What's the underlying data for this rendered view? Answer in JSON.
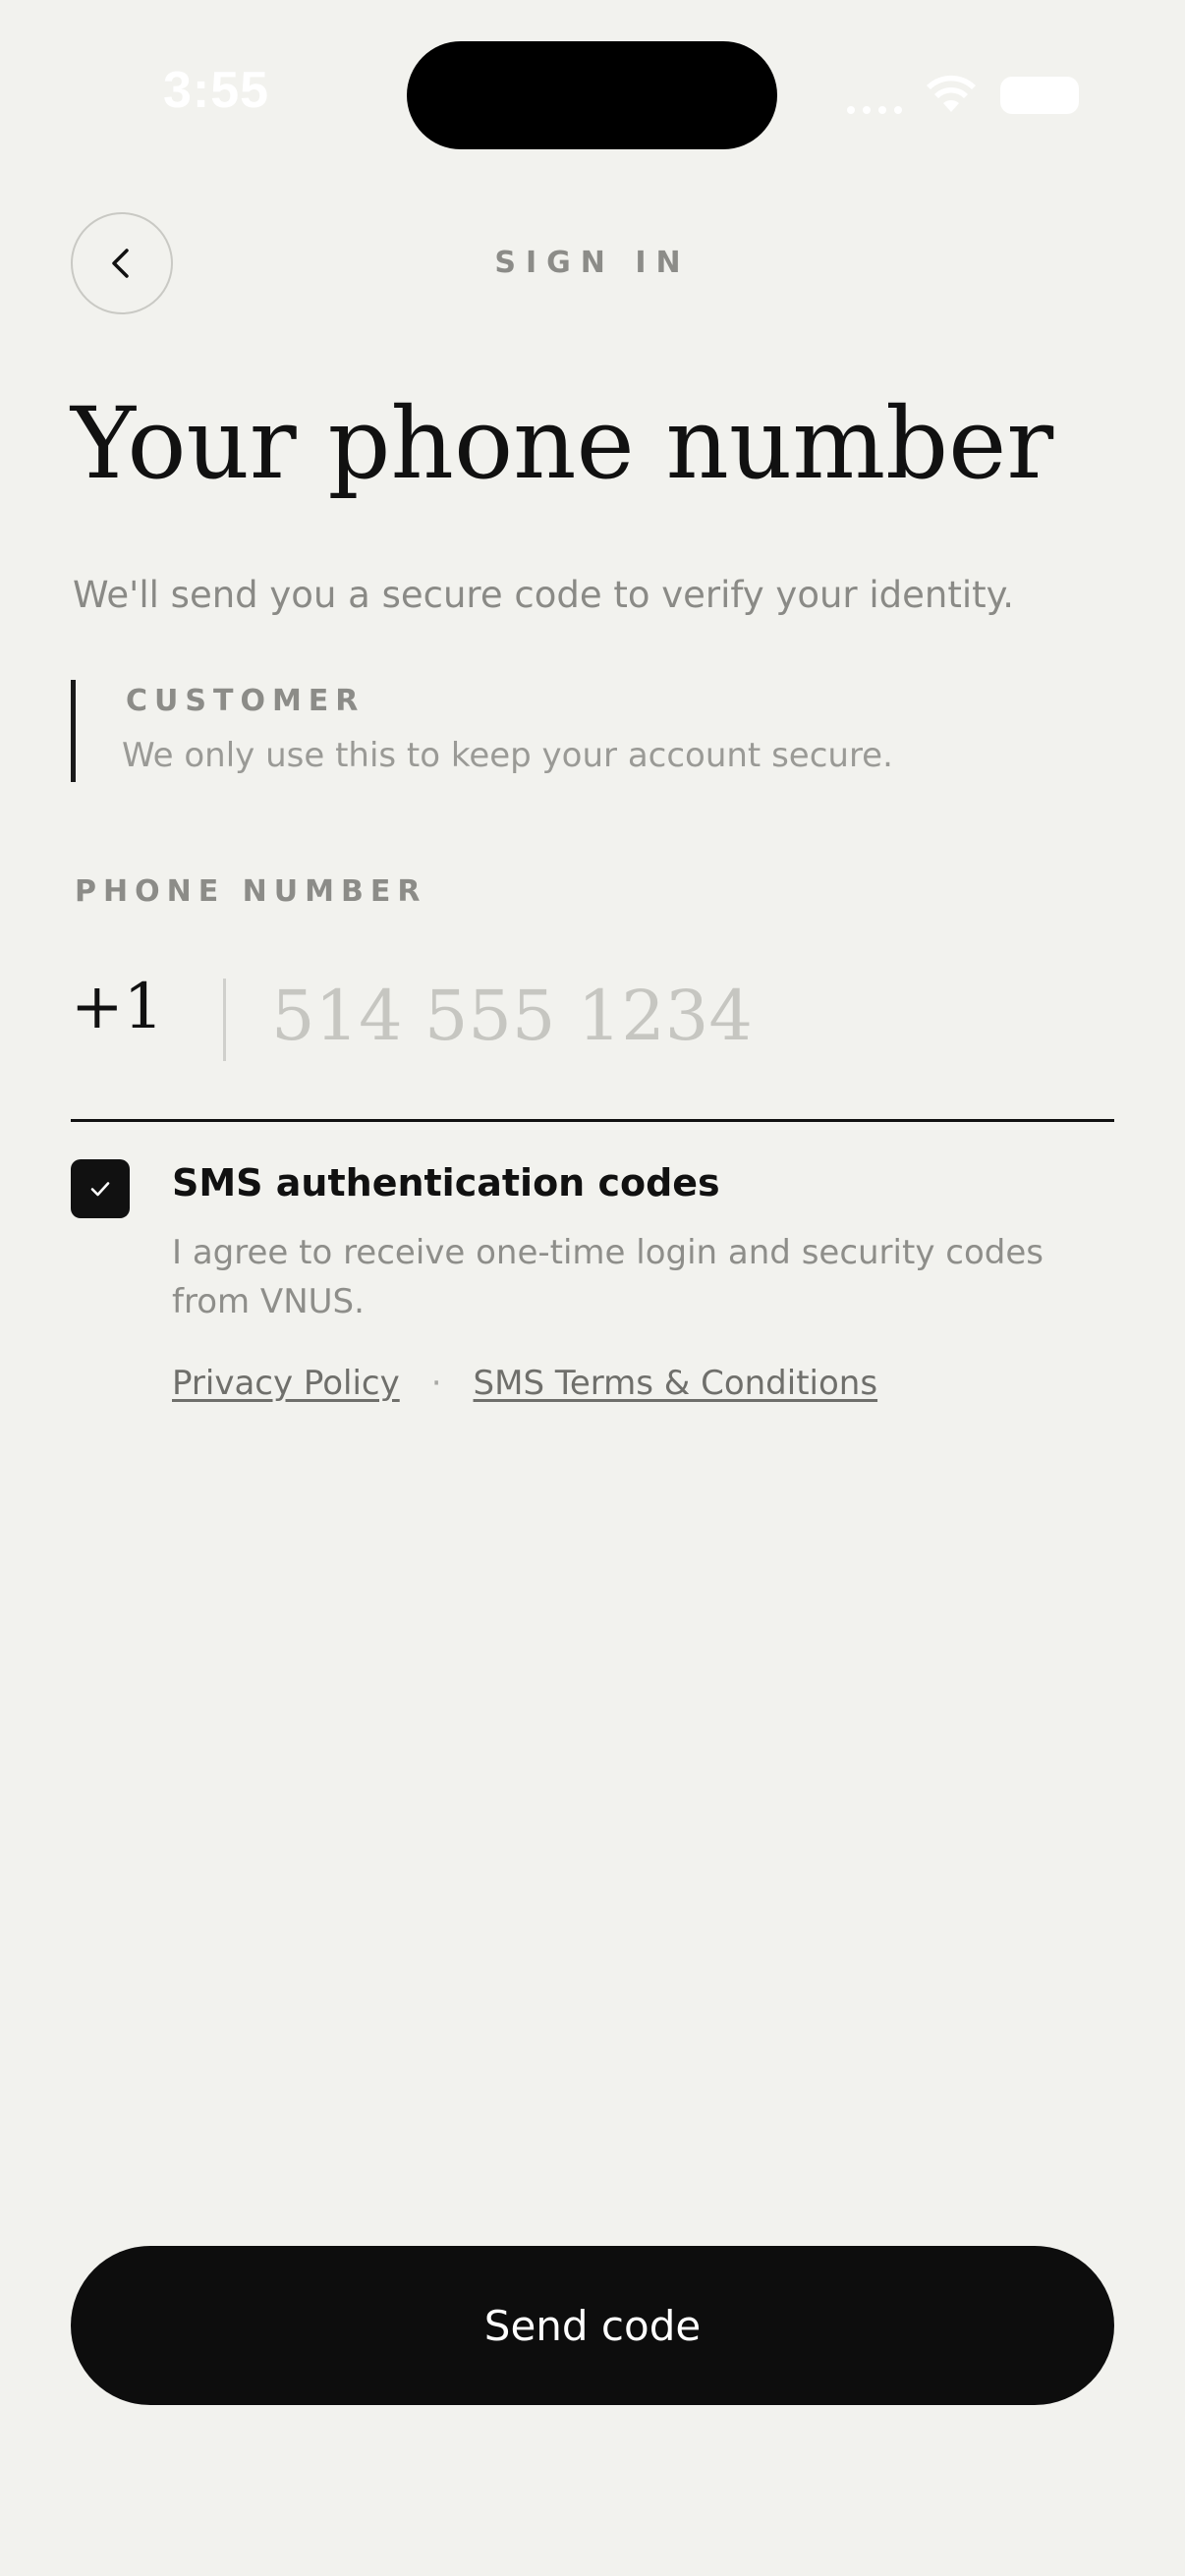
{
  "status_bar": {
    "time": "3:55",
    "icons": [
      "cellular-signal-icon",
      "wifi-icon",
      "battery-icon"
    ]
  },
  "header": {
    "back_icon": "chevron-left-icon",
    "title": "SIGN IN"
  },
  "main": {
    "title": "Your phone number",
    "subtitle": "We'll send you a secure code to verify your identity.",
    "customer": {
      "label": "CUSTOMER",
      "text": "We only use this to keep your account secure."
    },
    "phone": {
      "label": "PHONE NUMBER",
      "country_code": "+1",
      "value": "",
      "placeholder": "514 555 1234"
    },
    "consent": {
      "checked": true,
      "check_icon": "checkmark-icon",
      "title": "SMS authentication codes",
      "text": "I agree to receive one-time login and security codes from VNUS.",
      "privacy_link": "Privacy Policy",
      "separator": "·",
      "terms_link": "SMS Terms & Conditions"
    }
  },
  "footer": {
    "send_button": "Send code"
  },
  "colors": {
    "background": "#f2f2ee",
    "primary": "#0d0d0d",
    "muted_text": "#8c8c88",
    "placeholder": "#c6c6c1"
  }
}
